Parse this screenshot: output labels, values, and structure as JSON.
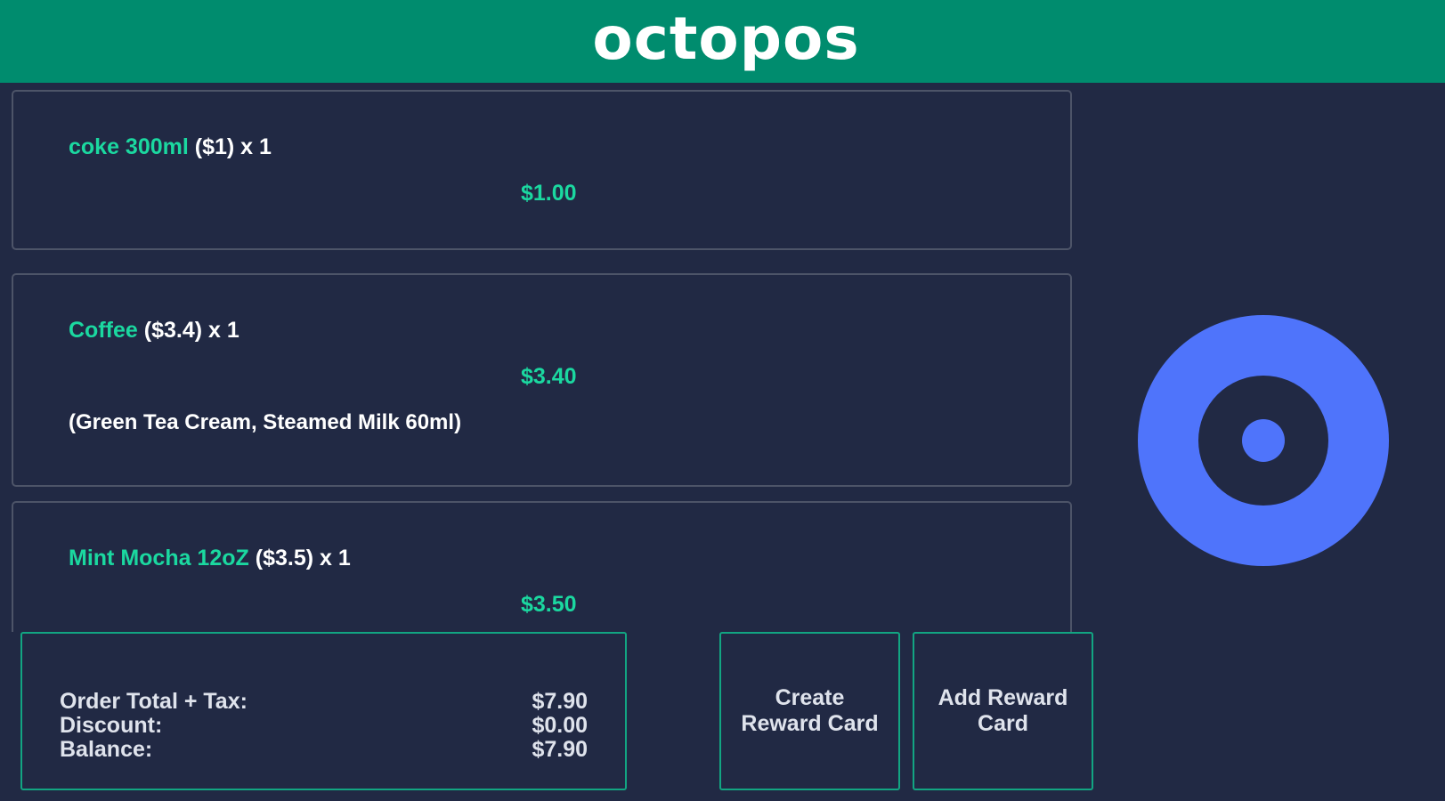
{
  "header": {
    "logo": "octopos"
  },
  "order": {
    "items": [
      {
        "name": "coke 300ml",
        "detail": " ($1) x 1",
        "price": "$1.00",
        "modifiers": ""
      },
      {
        "name": "Coffee",
        "detail": " ($3.4) x 1",
        "price": "$3.40",
        "modifiers": "(Green Tea Cream, Steamed Milk 60ml)"
      },
      {
        "name": "Mint Mocha 12oZ",
        "detail": " ($3.5) x 1",
        "price": "$3.50",
        "modifiers": ""
      }
    ]
  },
  "totals": {
    "order_total_label": "Order Total + Tax:",
    "order_total_value": "$7.90",
    "discount_label": "Discount:",
    "discount_value": "$0.00",
    "balance_label": "Balance:",
    "balance_value": "$7.90"
  },
  "actions": {
    "create_reward_card": "Create Reward Card",
    "add_reward_card": "Add Reward Card"
  },
  "icons": {
    "loading_indicator": "target-ring-icon"
  },
  "colors": {
    "header_bg": "#008c6e",
    "background": "#212944",
    "accent_green": "#1bd8a0",
    "button_border": "#12a582",
    "ring_blue": "#4f74fb"
  }
}
